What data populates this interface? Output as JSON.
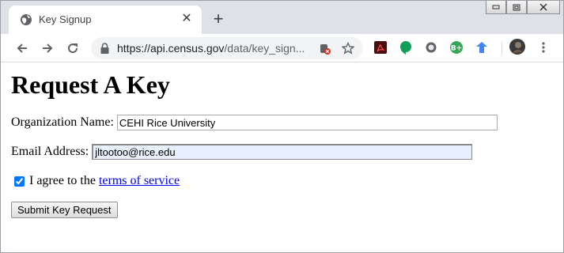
{
  "tab": {
    "title": "Key Signup"
  },
  "address_bar": {
    "url_main": "https://api.census.gov",
    "url_rest": "/data/key_sign..."
  },
  "page": {
    "heading": "Request A Key",
    "org_label": "Organization Name:",
    "org_value": "CEHI Rice University",
    "email_label": "Email Address:",
    "email_value": "jltootoo@rice.edu",
    "agree_text": "I agree to the ",
    "tos_link": "terms of service",
    "submit_label": "Submit Key Request"
  },
  "icons": [
    "globe-icon",
    "close-icon",
    "plus-icon",
    "back-icon",
    "forward-icon",
    "reload-icon",
    "lock-icon",
    "camera-blocked-icon",
    "star-icon",
    "acrobat-icon",
    "hangouts-icon",
    "extension-circle-icon",
    "google-plus-icon",
    "extension-arrow-icon",
    "avatar",
    "menu-icon"
  ],
  "colors": {
    "link": "#0000ee",
    "autofill_bg": "#e8f0fe"
  }
}
